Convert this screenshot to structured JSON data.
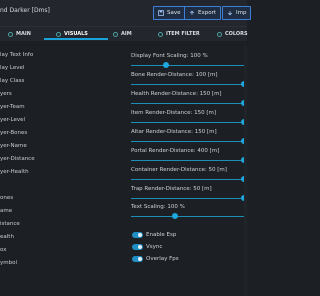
{
  "window": {
    "title": "nd Darker [Dms]",
    "buttons": [
      {
        "label": "Save",
        "icon": "save-icon"
      },
      {
        "label": "Export",
        "icon": "export-icon"
      },
      {
        "label": "Imp",
        "icon": "import-icon"
      }
    ]
  },
  "tabs": [
    {
      "label": "MAIN",
      "icon": "menu-icon"
    },
    {
      "label": "VISUALS",
      "icon": "eye-icon",
      "active": true
    },
    {
      "label": "AIM",
      "icon": "target-icon"
    },
    {
      "label": "ITEM FILTER",
      "icon": "filter-icon"
    },
    {
      "label": "COLORS",
      "icon": "palette-icon"
    }
  ],
  "left_list": [
    "lay Text Info",
    "lay Level",
    "lay Class",
    "yers",
    "yer-Team",
    "yer-Level",
    "yer-Bones",
    "yer-Name",
    "yer-Distance",
    "yer-Health",
    "ones",
    "ame",
    "istance",
    "ealth",
    "ox",
    "ymbol"
  ],
  "sliders": [
    {
      "label": "Display Font Scaling: 100 %",
      "fraction": 0.3
    },
    {
      "label": "Bone Render-Distance: 100 [m]",
      "fraction": 1.0
    },
    {
      "label": "Health Render-Distance: 150 [m]",
      "fraction": 1.0
    },
    {
      "label": "Item Render-Distance: 150 [m]",
      "fraction": 1.0
    },
    {
      "label": "Altar Render-Distance: 150 [m]",
      "fraction": 1.0
    },
    {
      "label": "Portal Render-Distance: 400 [m]",
      "fraction": 1.0
    },
    {
      "label": "Container Render-Distance: 50 [m]",
      "fraction": 1.0
    },
    {
      "label": "Trap Render-Distance: 50 [m]",
      "fraction": 1.0
    },
    {
      "label": "Text Scaling: 100 %",
      "fraction": 0.38
    }
  ],
  "toggles": [
    {
      "label": "Enable Esp",
      "on": true
    },
    {
      "label": "Vsync",
      "on": true
    },
    {
      "label": "Overlay Fps",
      "on": true
    }
  ],
  "accent_color": "#1da7dd"
}
